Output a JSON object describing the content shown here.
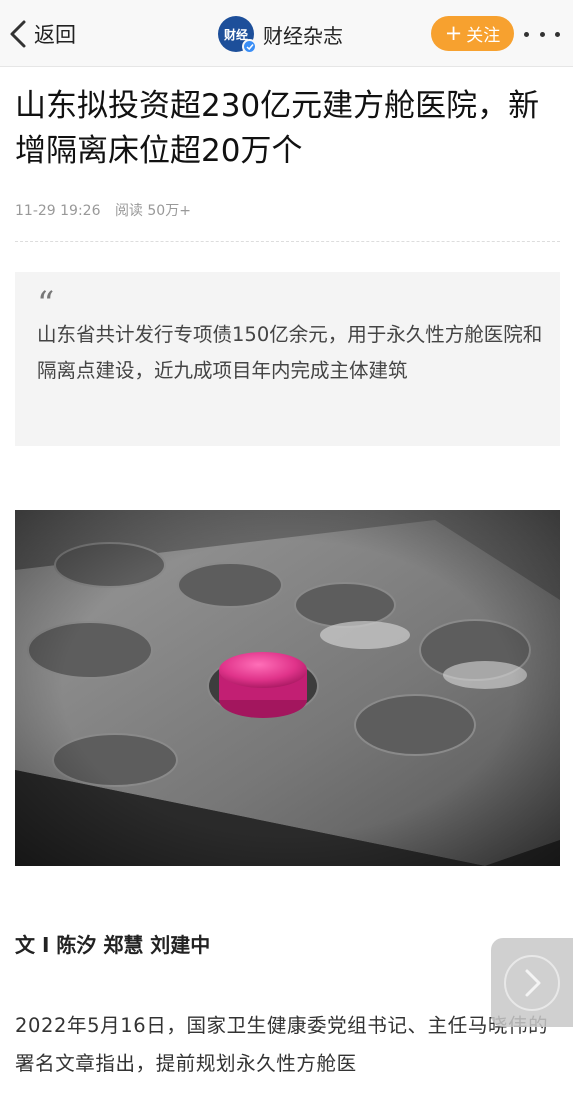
{
  "header": {
    "back_label": "返回",
    "brand_logo_text": "财经",
    "brand_name": "财经杂志",
    "follow_plus": "+",
    "follow_label": "关注"
  },
  "article": {
    "title": "山东拟投资超230亿元建方舱医院，新增隔离床位超20万个",
    "date": "11-29 19:26",
    "reads": "阅读 50万+",
    "quote_mark": "“",
    "summary": "山东省共计发行专项债150亿余元，用于永久性方舱医院和隔离点建设，近九成项目年内完成主体建筑",
    "byline": "文 I 陈汐 郑慧 刘建中",
    "body": "2022年5月16日，国家卫生健康委党组书记、主任马晓伟的署名文章指出，提前规划永久性方舱医"
  },
  "colors": {
    "follow_bg": "#f7a12f",
    "brand_blue": "#1d4f9a",
    "pill_pink": "#e0338a"
  },
  "icons": {
    "back": "chevron-left-icon",
    "more": "more-dots-icon",
    "verify": "verified-badge-icon",
    "next": "chevron-right-icon"
  }
}
